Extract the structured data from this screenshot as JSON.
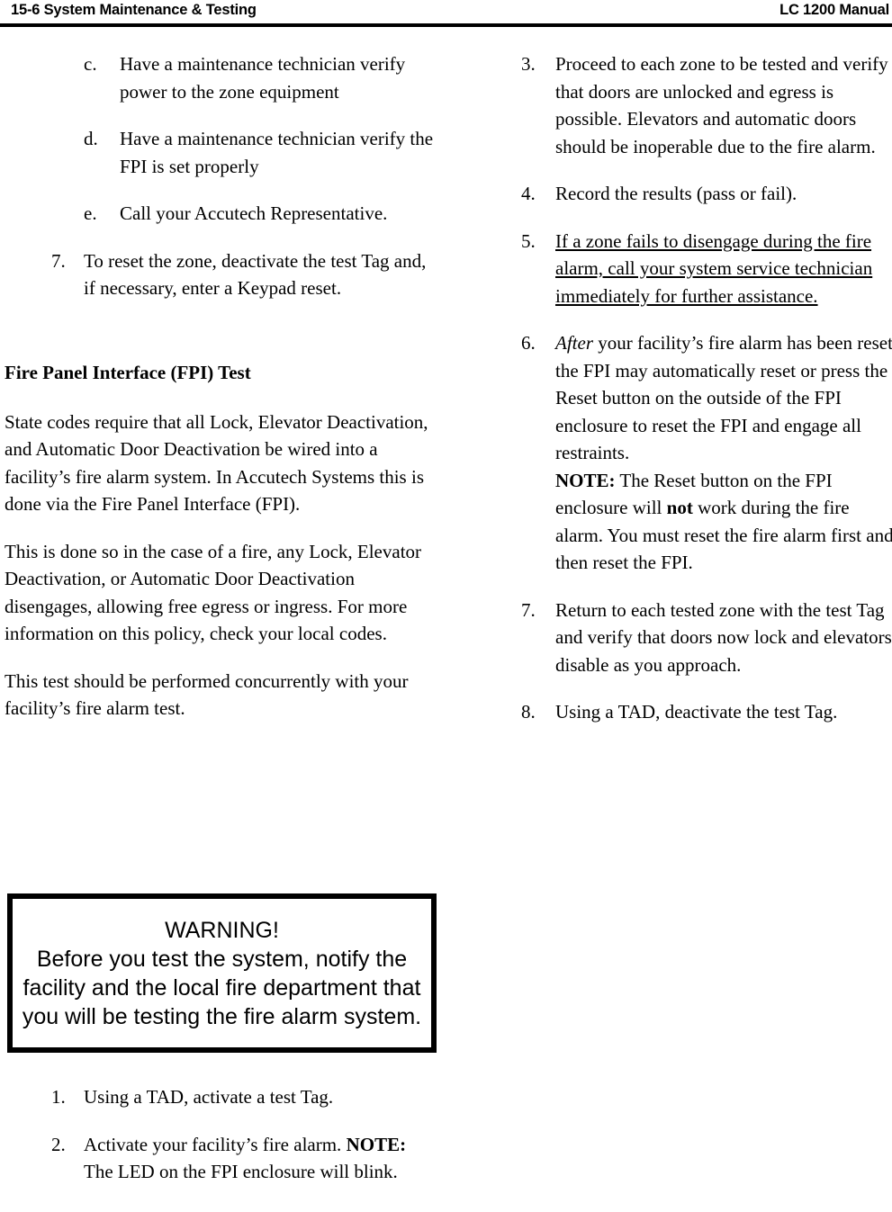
{
  "header": {
    "left": "15-6 System Maintenance & Testing",
    "right": "LC 1200 Manual"
  },
  "left_column": {
    "lettered_items": [
      {
        "marker": "c.",
        "text": "Have a maintenance technician verify power to the zone equipment"
      },
      {
        "marker": "d.",
        "text": "Have a maintenance technician verify the FPI is set properly"
      },
      {
        "marker": "e.",
        "text": "Call your Accutech Representative."
      }
    ],
    "numbered_item_7": {
      "marker": "7.",
      "text": "To reset the zone, deactivate the test Tag and, if necessary, enter a Keypad reset."
    },
    "section_heading": "Fire Panel Interface (FPI) Test",
    "paragraphs": [
      "State codes require that all Lock, Elevator Deactivation, and Automatic Door Deactivation be wired into a facility’s fire alarm system. In Accutech Systems this is done via the Fire Panel Interface (FPI).",
      "This is done so in the case of a fire, any Lock, Elevator Deactivation, or Automatic Door Deactivation disengages, allowing free egress or ingress. For more information on this policy, check your local codes.",
      "This test should be performed concurrently with your facility’s fire alarm test."
    ],
    "warning": {
      "title": "WARNING!",
      "body": "Before you test the system, notify the facility and the local fire department that you will be testing the fire alarm system."
    },
    "procedure_items": [
      {
        "marker": "1.",
        "text": "Using a TAD, activate a test Tag."
      },
      {
        "marker": "2.",
        "text": "Activate your facility’s fire alarm.",
        "note_label": "NOTE:",
        "note_text": "The LED on the FPI enclosure will blink."
      }
    ]
  },
  "right_column": {
    "items": [
      {
        "marker": "3.",
        "text": "Proceed to each zone to be tested and verify that doors are unlocked and egress is possible. Elevators and automatic doors should be inoperable due to the fire alarm."
      },
      {
        "marker": "4.",
        "text": "Record the results (pass or fail)."
      },
      {
        "marker": "5.",
        "text": "If a zone fails to disengage during the fire alarm, call your system service technician immediately for further assistance.",
        "style": "underline"
      },
      {
        "marker": "6.",
        "italic_lead": "After",
        "text": " your facility’s fire alarm has been reset the FPI may automatically reset or press the Reset button on the outside of the FPI enclosure to reset the FPI and engage all restraints.",
        "note_label": "NOTE:",
        "note_part1": "The Reset button on the FPI enclosure will ",
        "note_bold": "not",
        "note_part2": " work during the fire alarm. You must reset the fire alarm first and then reset the FPI."
      },
      {
        "marker": "7.",
        "text": "Return to each tested zone with the test Tag and verify that doors now lock and elevators disable as you approach."
      },
      {
        "marker": "8.",
        "text": "Using a TAD, deactivate the test Tag."
      }
    ]
  }
}
